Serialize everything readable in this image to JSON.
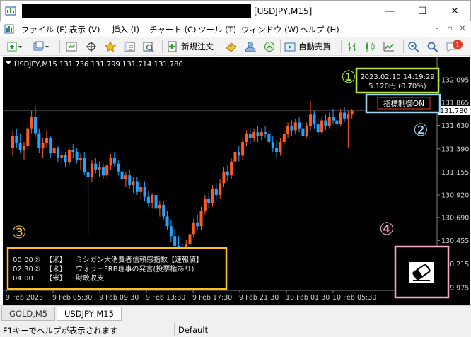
{
  "window": {
    "title": "[USDJPY,M15]",
    "minimize_glyph": "—",
    "maximize_glyph": "☐",
    "close_glyph": "✕",
    "app_icon": "metatrader-icon"
  },
  "menu": {
    "items": [
      "ファイル (F)",
      "表示 (V)",
      "挿入 (I)",
      "チャート (C)",
      "ツール (T)",
      "ウィンドウ (W)",
      "ヘルプ (H)"
    ],
    "mdi_minimize": "–",
    "mdi_restore": "▫",
    "mdi_close": "✕"
  },
  "toolbar": {
    "new_order_label": "新規注文",
    "auto_trade_label": "自動売買",
    "notification_count": "1",
    "icons": [
      "new-chart-icon",
      "profiles-icon",
      "market-watch-icon",
      "crosshair-icon",
      "favorites-icon",
      "terminal-icon",
      "strategy-tester-icon",
      "new-order-icon",
      "history-center-icon",
      "account-icon",
      "signals-icon",
      "auto-trading-icon",
      "bar-chart-icon",
      "candlestick-icon",
      "line-chart-icon",
      "zoom-in-icon",
      "search-icon",
      "notification-icon"
    ]
  },
  "chart": {
    "header": "USDJPY,M15  131.736 131.799 131.714 131.780",
    "bg_color": "#000000",
    "bull_color": "#ff5a1f",
    "bear_color": "#1fa5ff",
    "price_ticks": [
      "132.095",
      "131.865",
      "131.630",
      "131.390",
      "131.155",
      "130.920",
      "130.690",
      "130.455",
      "130.215",
      "129.975"
    ],
    "current_price": "131.780",
    "time_ticks": [
      "9 Feb 2023",
      "9 Feb 05:30",
      "9 Feb 09:30",
      "9 Feb 13:30",
      "9 Feb 17:30",
      "9 Feb 21:30",
      "10 Feb 01:30",
      "10 Feb 05:30"
    ],
    "info_datetime": "2023.02.10  14:19:29",
    "info_change": "5.120円 (0.70%)",
    "indicator_control": "指標制御ON",
    "markers": [
      "①",
      "②",
      "③",
      "④"
    ],
    "marker_colors": [
      "#b6e53c",
      "#9fd5f0",
      "#ffbe1e",
      "#f5a9c8"
    ],
    "news": [
      {
        "time": "00:00",
        "rank": "②",
        "region": "【米】",
        "event": "ミシガン大消費者信頼感指数【速報値】"
      },
      {
        "time": "02:30",
        "rank": "②",
        "region": "【米】",
        "event": "ウォラーFRB理事の発言(投票権あり)"
      },
      {
        "time": "04:00",
        "rank": "",
        "region": "【米】",
        "event": "財政収支"
      }
    ],
    "eraser_icon": "eraser-icon",
    "candles": [
      {
        "o": 131.4,
        "h": 131.58,
        "l": 131.32,
        "c": 131.52
      },
      {
        "o": 131.52,
        "h": 131.6,
        "l": 131.4,
        "c": 131.45
      },
      {
        "o": 131.45,
        "h": 131.55,
        "l": 131.35,
        "c": 131.38
      },
      {
        "o": 131.38,
        "h": 131.46,
        "l": 131.28,
        "c": 131.42
      },
      {
        "o": 131.42,
        "h": 131.64,
        "l": 131.38,
        "c": 131.6
      },
      {
        "o": 131.6,
        "h": 131.78,
        "l": 131.55,
        "c": 131.72
      },
      {
        "o": 131.72,
        "h": 131.83,
        "l": 131.5,
        "c": 131.55
      },
      {
        "o": 131.55,
        "h": 131.6,
        "l": 131.35,
        "c": 131.4
      },
      {
        "o": 131.4,
        "h": 131.5,
        "l": 131.3,
        "c": 131.45
      },
      {
        "o": 131.45,
        "h": 131.58,
        "l": 131.4,
        "c": 131.5
      },
      {
        "o": 131.5,
        "h": 131.52,
        "l": 131.3,
        "c": 131.35
      },
      {
        "o": 131.35,
        "h": 131.45,
        "l": 131.28,
        "c": 131.4
      },
      {
        "o": 131.4,
        "h": 131.42,
        "l": 131.25,
        "c": 131.3
      },
      {
        "o": 131.3,
        "h": 131.38,
        "l": 131.22,
        "c": 131.33
      },
      {
        "o": 131.33,
        "h": 131.36,
        "l": 131.2,
        "c": 131.25
      },
      {
        "o": 131.25,
        "h": 131.4,
        "l": 131.22,
        "c": 131.38
      },
      {
        "o": 131.38,
        "h": 131.44,
        "l": 131.3,
        "c": 131.36
      },
      {
        "o": 131.36,
        "h": 131.4,
        "l": 131.24,
        "c": 131.28
      },
      {
        "o": 131.28,
        "h": 131.34,
        "l": 131.18,
        "c": 131.3
      },
      {
        "o": 131.3,
        "h": 131.36,
        "l": 131.12,
        "c": 131.15
      },
      {
        "o": 131.15,
        "h": 131.2,
        "l": 130.5,
        "c": 131.1
      },
      {
        "o": 131.1,
        "h": 131.28,
        "l": 131.05,
        "c": 131.24
      },
      {
        "o": 131.24,
        "h": 131.3,
        "l": 131.14,
        "c": 131.18
      },
      {
        "o": 131.18,
        "h": 131.26,
        "l": 131.1,
        "c": 131.2
      },
      {
        "o": 131.2,
        "h": 131.24,
        "l": 131.08,
        "c": 131.12
      },
      {
        "o": 131.12,
        "h": 131.24,
        "l": 131.08,
        "c": 131.22
      },
      {
        "o": 131.22,
        "h": 131.34,
        "l": 131.18,
        "c": 131.3
      },
      {
        "o": 131.3,
        "h": 131.36,
        "l": 131.2,
        "c": 131.24
      },
      {
        "o": 131.24,
        "h": 131.28,
        "l": 131.12,
        "c": 131.16
      },
      {
        "o": 131.16,
        "h": 131.2,
        "l": 131.06,
        "c": 131.08
      },
      {
        "o": 131.08,
        "h": 131.16,
        "l": 131.0,
        "c": 131.12
      },
      {
        "o": 131.12,
        "h": 131.18,
        "l": 130.98,
        "c": 131.02
      },
      {
        "o": 131.02,
        "h": 131.1,
        "l": 130.94,
        "c": 131.06
      },
      {
        "o": 131.06,
        "h": 131.1,
        "l": 130.92,
        "c": 130.95
      },
      {
        "o": 130.95,
        "h": 131.04,
        "l": 130.88,
        "c": 131.0
      },
      {
        "o": 131.0,
        "h": 131.06,
        "l": 130.86,
        "c": 130.9
      },
      {
        "o": 130.9,
        "h": 130.96,
        "l": 130.8,
        "c": 130.84
      },
      {
        "o": 130.84,
        "h": 130.94,
        "l": 130.78,
        "c": 130.92
      },
      {
        "o": 130.92,
        "h": 130.96,
        "l": 130.74,
        "c": 130.78
      },
      {
        "o": 130.78,
        "h": 130.86,
        "l": 130.7,
        "c": 130.82
      },
      {
        "o": 130.82,
        "h": 130.86,
        "l": 130.66,
        "c": 130.7
      },
      {
        "o": 130.7,
        "h": 130.76,
        "l": 130.56,
        "c": 130.6
      },
      {
        "o": 130.6,
        "h": 130.66,
        "l": 130.44,
        "c": 130.5
      },
      {
        "o": 130.5,
        "h": 130.56,
        "l": 130.36,
        "c": 130.4
      },
      {
        "o": 130.4,
        "h": 130.5,
        "l": 130.3,
        "c": 130.34
      },
      {
        "o": 130.34,
        "h": 130.42,
        "l": 130.18,
        "c": 130.26
      },
      {
        "o": 130.26,
        "h": 130.46,
        "l": 130.22,
        "c": 130.42
      },
      {
        "o": 130.42,
        "h": 130.56,
        "l": 130.38,
        "c": 130.52
      },
      {
        "o": 130.52,
        "h": 130.68,
        "l": 130.48,
        "c": 130.64
      },
      {
        "o": 130.64,
        "h": 130.72,
        "l": 130.56,
        "c": 130.6
      },
      {
        "o": 130.6,
        "h": 130.8,
        "l": 130.56,
        "c": 130.76
      },
      {
        "o": 130.76,
        "h": 130.92,
        "l": 130.72,
        "c": 130.88
      },
      {
        "o": 130.88,
        "h": 130.94,
        "l": 130.78,
        "c": 130.84
      },
      {
        "o": 130.84,
        "h": 131.02,
        "l": 130.8,
        "c": 130.98
      },
      {
        "o": 130.98,
        "h": 131.04,
        "l": 130.86,
        "c": 130.92
      },
      {
        "o": 130.92,
        "h": 131.08,
        "l": 130.88,
        "c": 131.04
      },
      {
        "o": 131.04,
        "h": 131.2,
        "l": 131.0,
        "c": 131.16
      },
      {
        "o": 131.16,
        "h": 131.22,
        "l": 131.06,
        "c": 131.12
      },
      {
        "o": 131.12,
        "h": 131.3,
        "l": 131.08,
        "c": 131.26
      },
      {
        "o": 131.26,
        "h": 131.4,
        "l": 131.22,
        "c": 131.36
      },
      {
        "o": 131.36,
        "h": 131.42,
        "l": 131.26,
        "c": 131.32
      },
      {
        "o": 131.32,
        "h": 131.5,
        "l": 131.28,
        "c": 131.46
      },
      {
        "o": 131.46,
        "h": 131.58,
        "l": 131.42,
        "c": 131.54
      },
      {
        "o": 131.54,
        "h": 131.6,
        "l": 131.44,
        "c": 131.5
      },
      {
        "o": 131.5,
        "h": 131.6,
        "l": 131.46,
        "c": 131.56
      },
      {
        "o": 131.56,
        "h": 131.62,
        "l": 131.46,
        "c": 131.52
      },
      {
        "o": 131.52,
        "h": 131.6,
        "l": 131.48,
        "c": 131.56
      },
      {
        "o": 131.56,
        "h": 131.62,
        "l": 131.5,
        "c": 131.54
      },
      {
        "o": 131.54,
        "h": 131.58,
        "l": 131.42,
        "c": 131.46
      },
      {
        "o": 131.46,
        "h": 131.52,
        "l": 131.36,
        "c": 131.4
      },
      {
        "o": 131.4,
        "h": 131.48,
        "l": 131.3,
        "c": 131.36
      },
      {
        "o": 131.36,
        "h": 131.5,
        "l": 131.32,
        "c": 131.46
      },
      {
        "o": 131.46,
        "h": 131.58,
        "l": 131.42,
        "c": 131.54
      },
      {
        "o": 131.54,
        "h": 131.66,
        "l": 131.5,
        "c": 131.62
      },
      {
        "o": 131.62,
        "h": 131.68,
        "l": 131.52,
        "c": 131.58
      },
      {
        "o": 131.58,
        "h": 131.7,
        "l": 131.54,
        "c": 131.66
      },
      {
        "o": 131.66,
        "h": 131.72,
        "l": 131.56,
        "c": 131.6
      },
      {
        "o": 131.6,
        "h": 131.66,
        "l": 131.48,
        "c": 131.52
      },
      {
        "o": 131.52,
        "h": 131.66,
        "l": 131.5,
        "c": 131.62
      },
      {
        "o": 131.62,
        "h": 131.88,
        "l": 131.58,
        "c": 131.74
      },
      {
        "o": 131.74,
        "h": 131.78,
        "l": 131.6,
        "c": 131.64
      },
      {
        "o": 131.64,
        "h": 131.7,
        "l": 131.52,
        "c": 131.56
      },
      {
        "o": 131.56,
        "h": 131.72,
        "l": 131.54,
        "c": 131.68
      },
      {
        "o": 131.68,
        "h": 131.74,
        "l": 131.58,
        "c": 131.62
      },
      {
        "o": 131.62,
        "h": 131.76,
        "l": 131.6,
        "c": 131.72
      },
      {
        "o": 131.72,
        "h": 131.8,
        "l": 131.64,
        "c": 131.68
      },
      {
        "o": 131.68,
        "h": 131.72,
        "l": 131.58,
        "c": 131.64
      },
      {
        "o": 131.64,
        "h": 131.8,
        "l": 131.62,
        "c": 131.76
      },
      {
        "o": 131.76,
        "h": 131.82,
        "l": 131.66,
        "c": 131.7
      },
      {
        "o": 131.7,
        "h": 131.78,
        "l": 131.4,
        "c": 131.74
      },
      {
        "o": 131.74,
        "h": 131.8,
        "l": 131.7,
        "c": 131.78
      }
    ]
  },
  "tabs": [
    "GOLD,M5",
    "USDJPY,M15"
  ],
  "status": {
    "help": "F1キーでヘルプが表示されます",
    "profile": "Default"
  }
}
